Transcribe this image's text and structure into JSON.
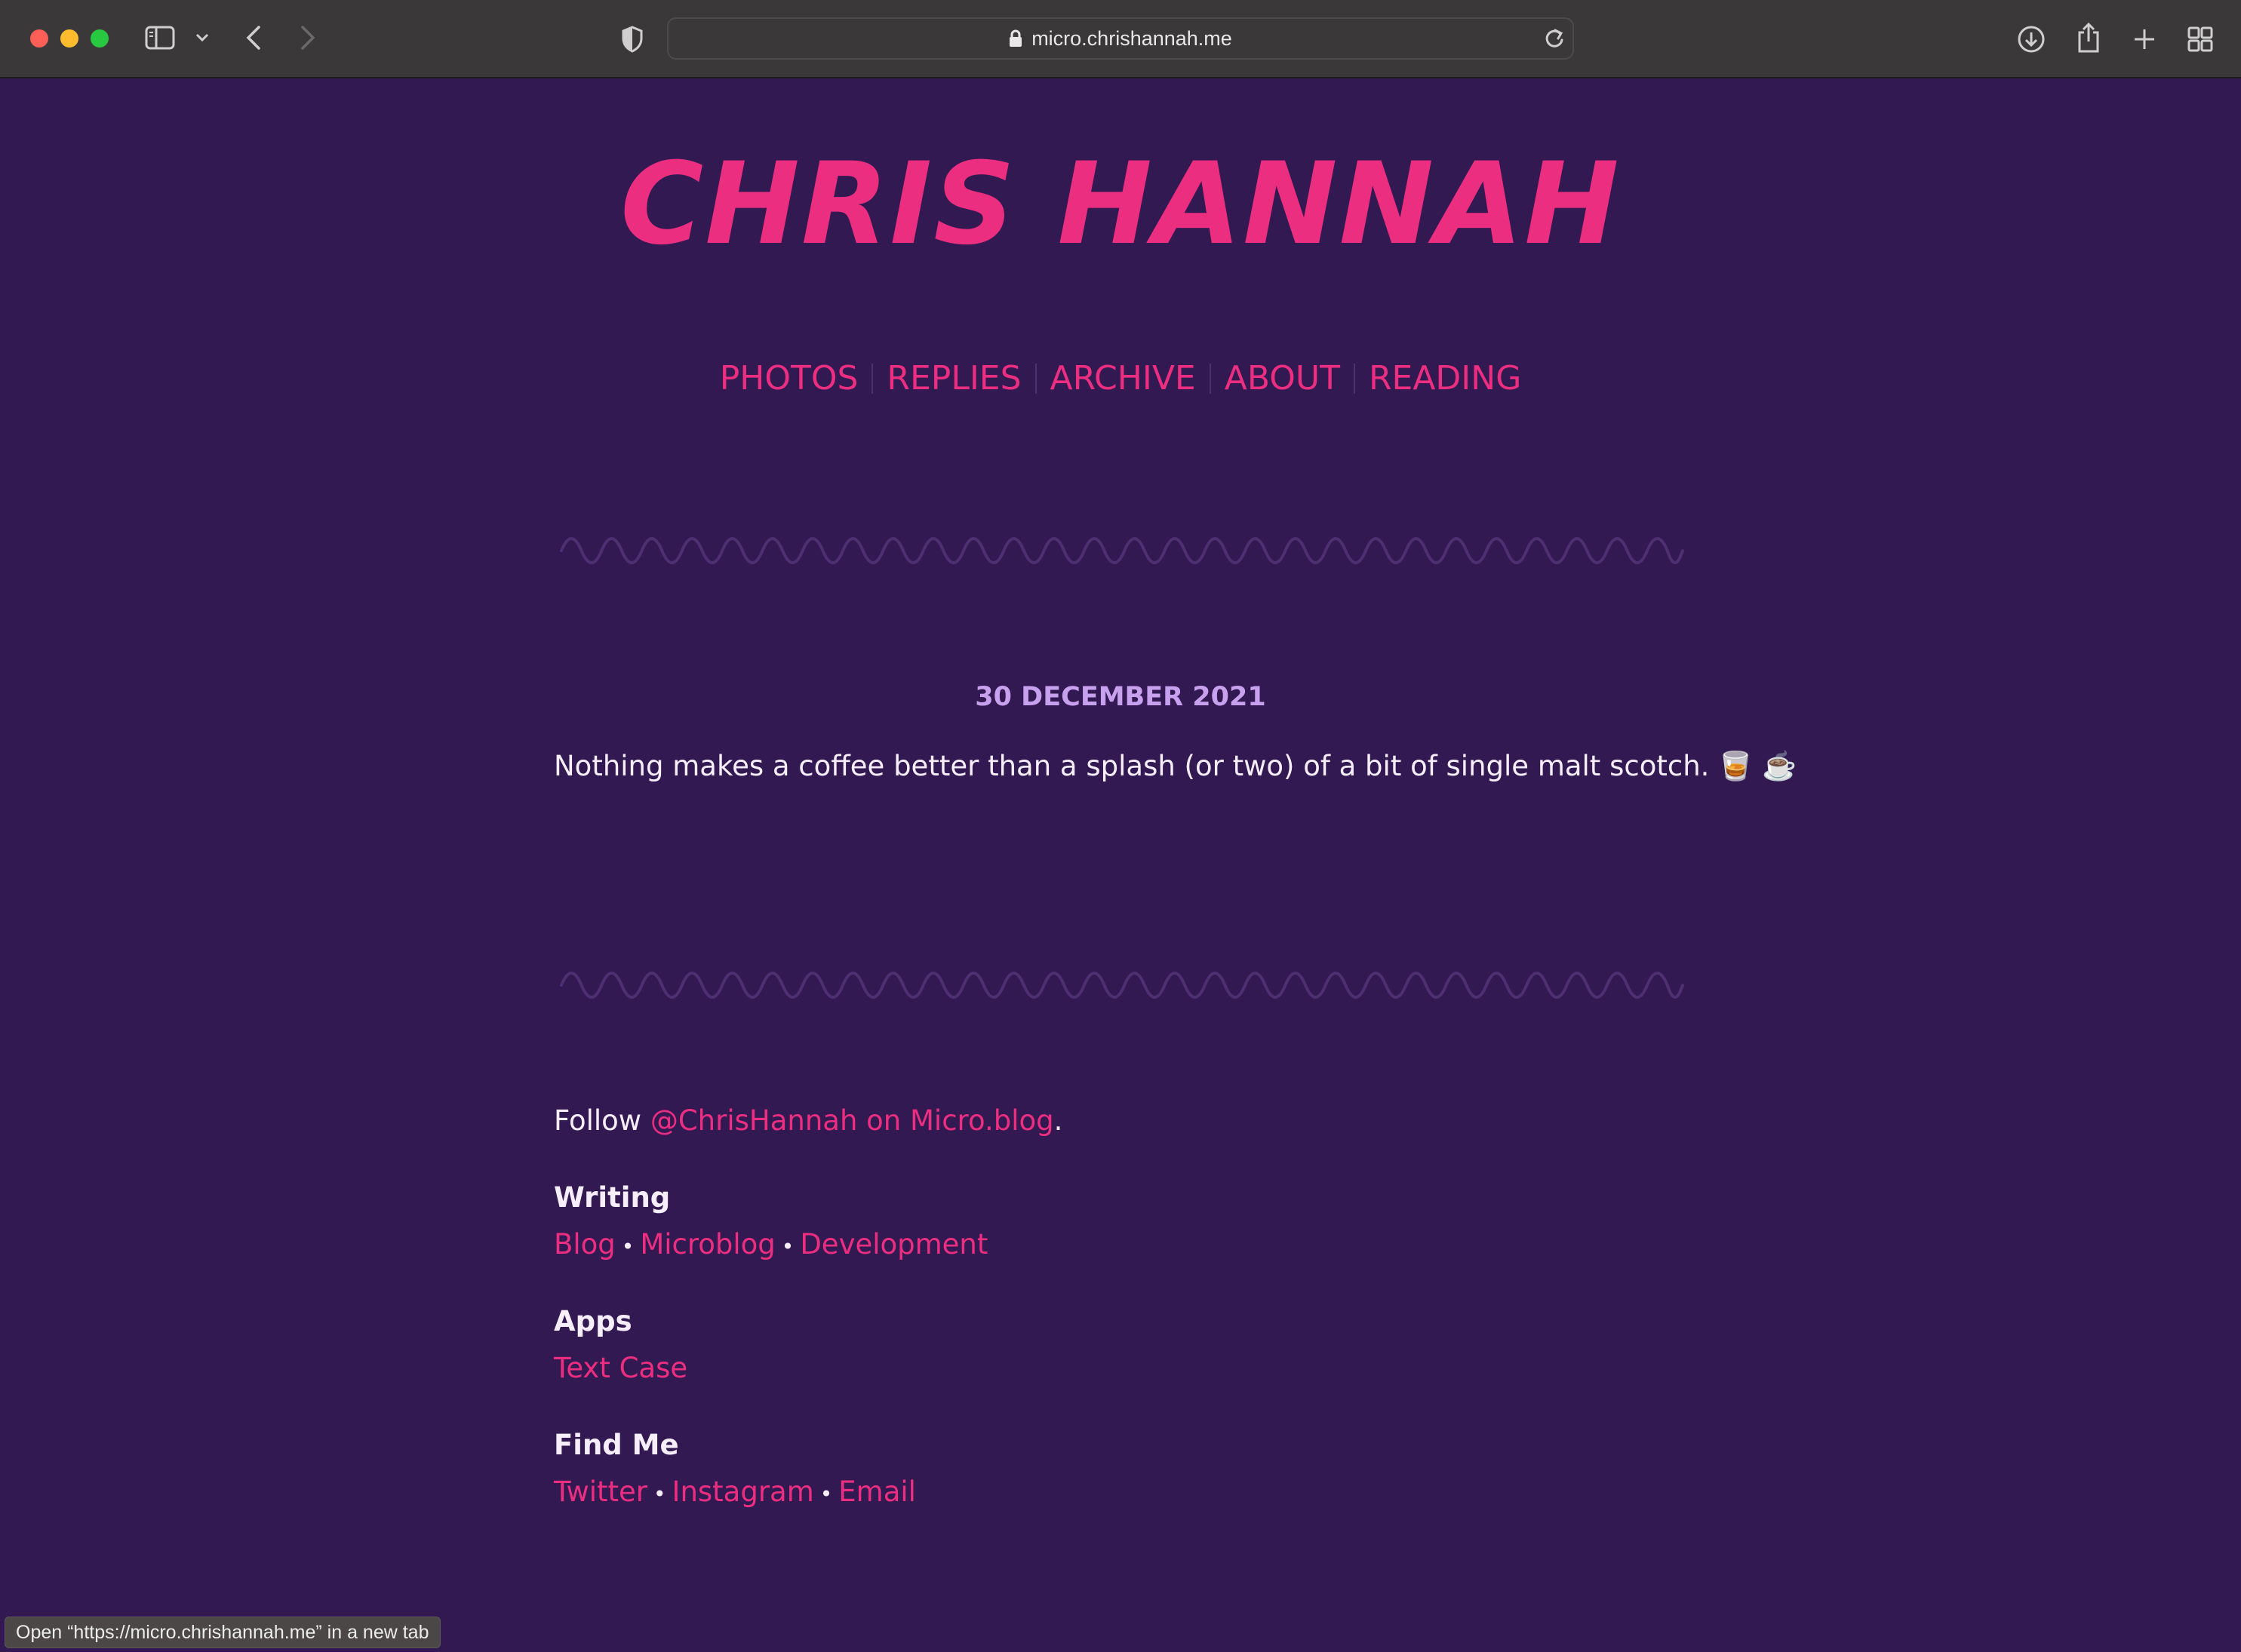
{
  "browser": {
    "url": "micro.chrishannah.me",
    "status_text": "Open “https://micro.chrishannah.me” in a new tab",
    "icons": [
      "sidebar-icon",
      "chevron-down-icon",
      "back-icon",
      "forward-icon",
      "privacy-shield-icon",
      "lock-icon",
      "reload-icon",
      "download-icon",
      "share-icon",
      "new-tab-icon",
      "tab-overview-icon"
    ]
  },
  "site": {
    "title": "CHRIS HANNAH",
    "nav": [
      {
        "label": "PHOTOS"
      },
      {
        "label": "REPLIES"
      },
      {
        "label": "ARCHIVE"
      },
      {
        "label": "ABOUT"
      },
      {
        "label": "READING"
      }
    ]
  },
  "post": {
    "date": "30 DECEMBER 2021",
    "body": "Nothing makes a coffee better than a splash (or two) of a bit of single malt scotch. 🥃 ☕️"
  },
  "footer": {
    "follow_prefix": "Follow ",
    "follow_link": "@ChrisHannah on Micro.blog",
    "follow_suffix": ".",
    "writing_heading": "Writing",
    "writing_links": [
      "Blog",
      "Microblog",
      "Development"
    ],
    "apps_heading": "Apps",
    "apps_links": [
      "Text Case"
    ],
    "find_heading": "Find Me",
    "find_links": [
      "Twitter",
      "Instagram",
      "Email"
    ],
    "separator": "•"
  },
  "colors": {
    "background": "#331952",
    "accent": "#ec2e80",
    "date": "#c7a1ee",
    "text": "#f6eefb",
    "wave": "#4e2f72"
  }
}
